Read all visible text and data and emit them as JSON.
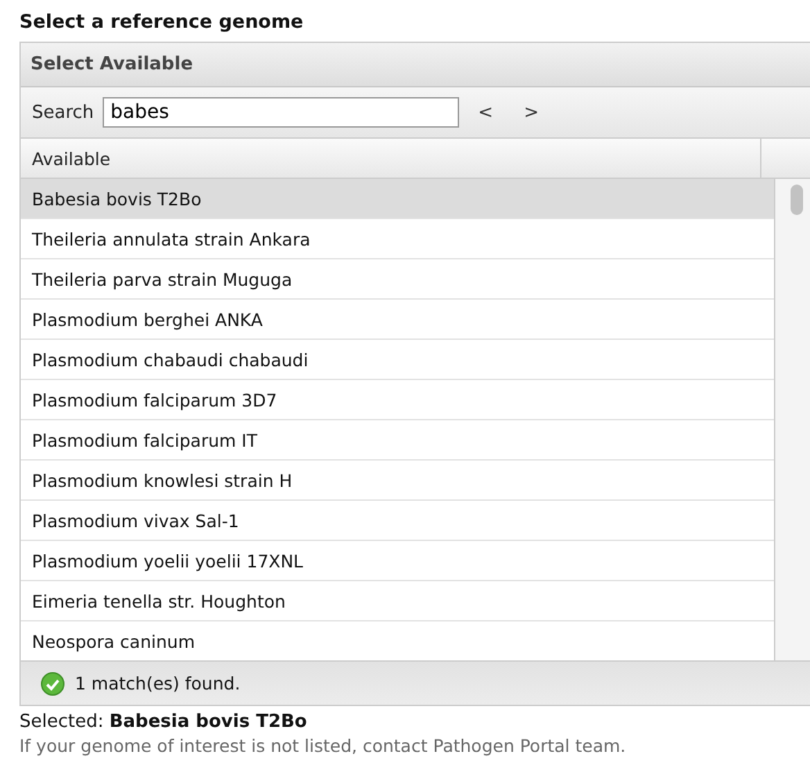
{
  "title": "Select a reference genome",
  "panel": {
    "header": "Select Available",
    "search": {
      "label": "Search",
      "value": "babes",
      "prev": "<",
      "next": ">"
    },
    "column": "Available",
    "rows": [
      {
        "name": "Babesia bovis T2Bo",
        "selected": true
      },
      {
        "name": "Theileria annulata strain Ankara",
        "selected": false
      },
      {
        "name": "Theileria parva strain Muguga",
        "selected": false
      },
      {
        "name": "Plasmodium berghei ANKA",
        "selected": false
      },
      {
        "name": "Plasmodium chabaudi chabaudi",
        "selected": false
      },
      {
        "name": "Plasmodium falciparum 3D7",
        "selected": false
      },
      {
        "name": "Plasmodium falciparum IT",
        "selected": false
      },
      {
        "name": "Plasmodium knowlesi strain H",
        "selected": false
      },
      {
        "name": "Plasmodium vivax Sal-1",
        "selected": false
      },
      {
        "name": "Plasmodium yoelii yoelii 17XNL",
        "selected": false
      },
      {
        "name": "Eimeria tenella str. Houghton",
        "selected": false
      },
      {
        "name": "Neospora caninum",
        "selected": false
      }
    ],
    "status": "1 match(es) found."
  },
  "selected": "Selected: **Babesia bovis T2Bo**",
  "note": "If your genome of interest is not listed, contact Pathogen Portal team."
}
